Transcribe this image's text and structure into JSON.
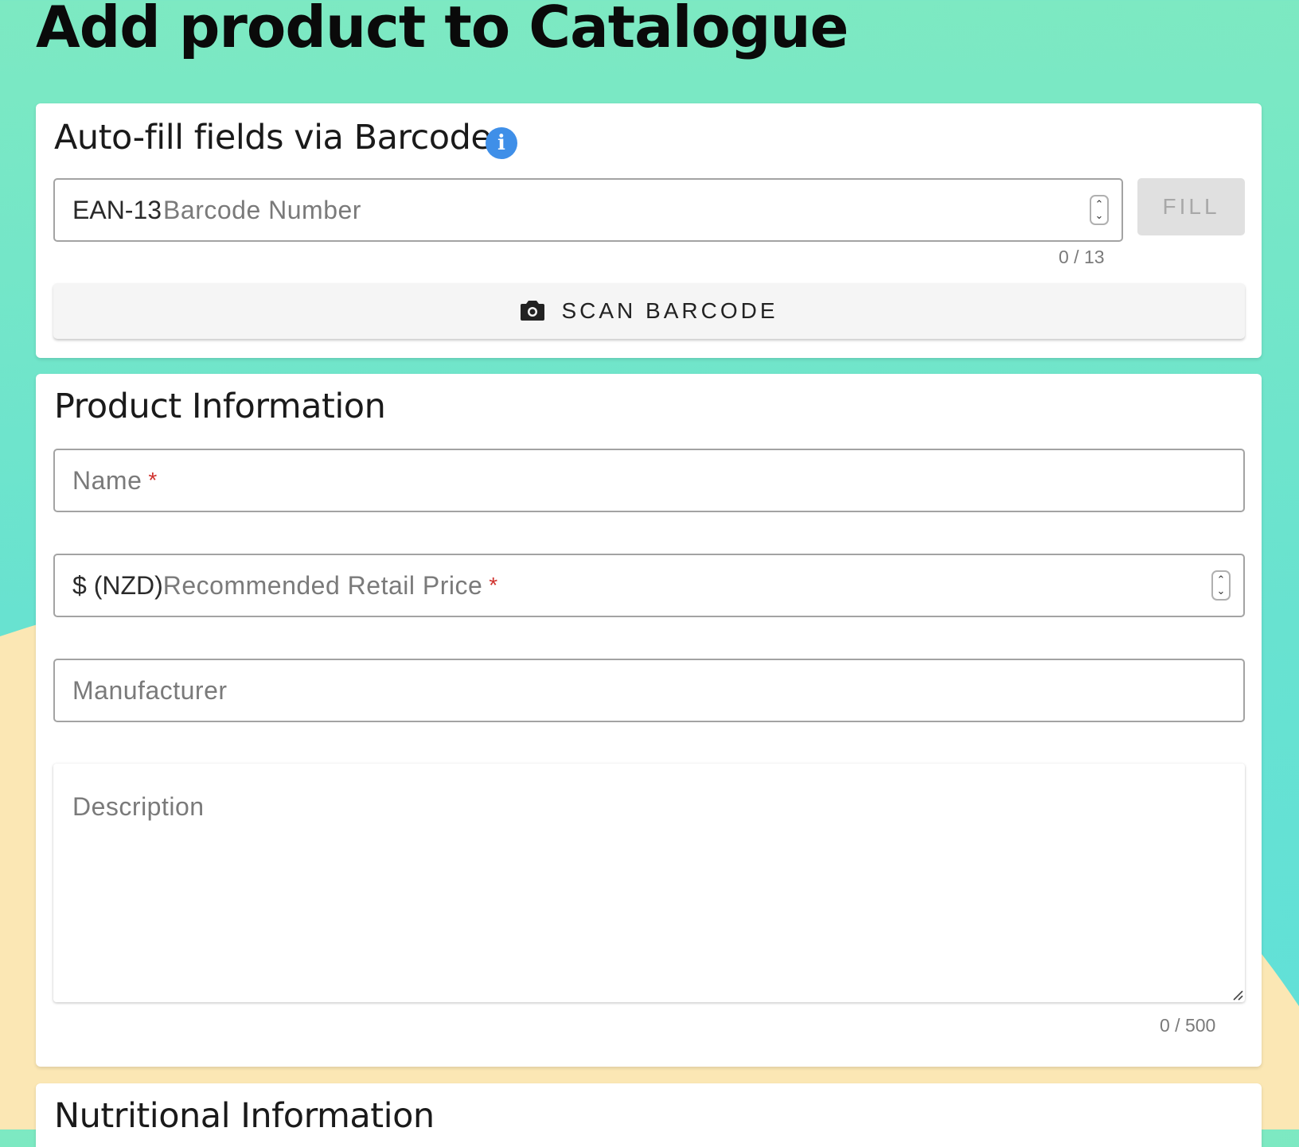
{
  "page": {
    "title": "Add product to Catalogue"
  },
  "colors": {
    "bg_top": "#7de9c2",
    "bg_bottom": "#5fe0da",
    "sand": "#fbe7b4",
    "info_icon": "#3f8fe8",
    "required": "#d0312d"
  },
  "barcode_card": {
    "heading": "Auto-fill fields via Barcode",
    "info_icon": "info-icon",
    "barcode_field": {
      "prefix": "EAN-13",
      "placeholder": "Barcode Number",
      "value": "",
      "counter": "0 / 13"
    },
    "fill_button": "FILL",
    "scan_button": {
      "icon": "camera-icon",
      "label": "SCAN BARCODE"
    }
  },
  "product_card": {
    "heading": "Product Information",
    "name_field": {
      "label": "Name",
      "required_mark": "*"
    },
    "price_field": {
      "prefix": "$ (NZD)",
      "label": "Recommended Retail Price",
      "required_mark": "*"
    },
    "manufacturer_field": {
      "label": "Manufacturer"
    },
    "description_field": {
      "label": "Description",
      "counter": "0 / 500"
    }
  },
  "nutrition_card": {
    "heading": "Nutritional Information"
  }
}
